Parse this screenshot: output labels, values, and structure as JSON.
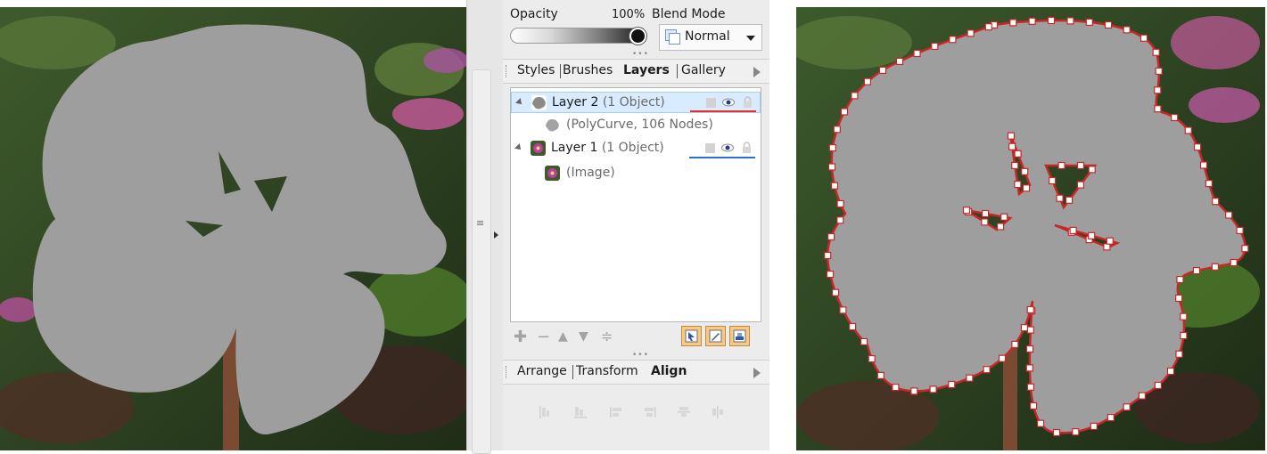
{
  "panel": {
    "opacity_label": "Opacity",
    "opacity_value": "100%",
    "opacity_fraction": 1.0,
    "blend_label": "Blend Mode",
    "blend_value": "Normal",
    "tabs_top": [
      "Styles",
      "Brushes",
      "Layers",
      "Gallery"
    ],
    "active_top_tab": "Layers",
    "tabs_bottom": [
      "Arrange",
      "Transform",
      "Align"
    ],
    "active_bottom_tab": "Align"
  },
  "layers": [
    {
      "name": "Layer 2",
      "count": "(1 Object)",
      "child": "(PolyCurve, 106 Nodes)",
      "underline_color": "#e23030",
      "selected": true
    },
    {
      "name": "Layer 1",
      "count": "(1 Object)",
      "child": "(Image)",
      "underline_color": "#2a6fd6",
      "selected": false
    }
  ],
  "icons": {
    "add": "add-layer-icon",
    "remove": "delete-layer-icon",
    "up": "move-layer-up-icon",
    "down": "move-layer-down-icon",
    "merge": "merge-layers-icon"
  },
  "colors": {
    "selection_fill": "#d9ecff",
    "mask_gray": "#9e9e9e",
    "curve_red": "#d32f2f",
    "toggle_orange": "#f5c987"
  }
}
